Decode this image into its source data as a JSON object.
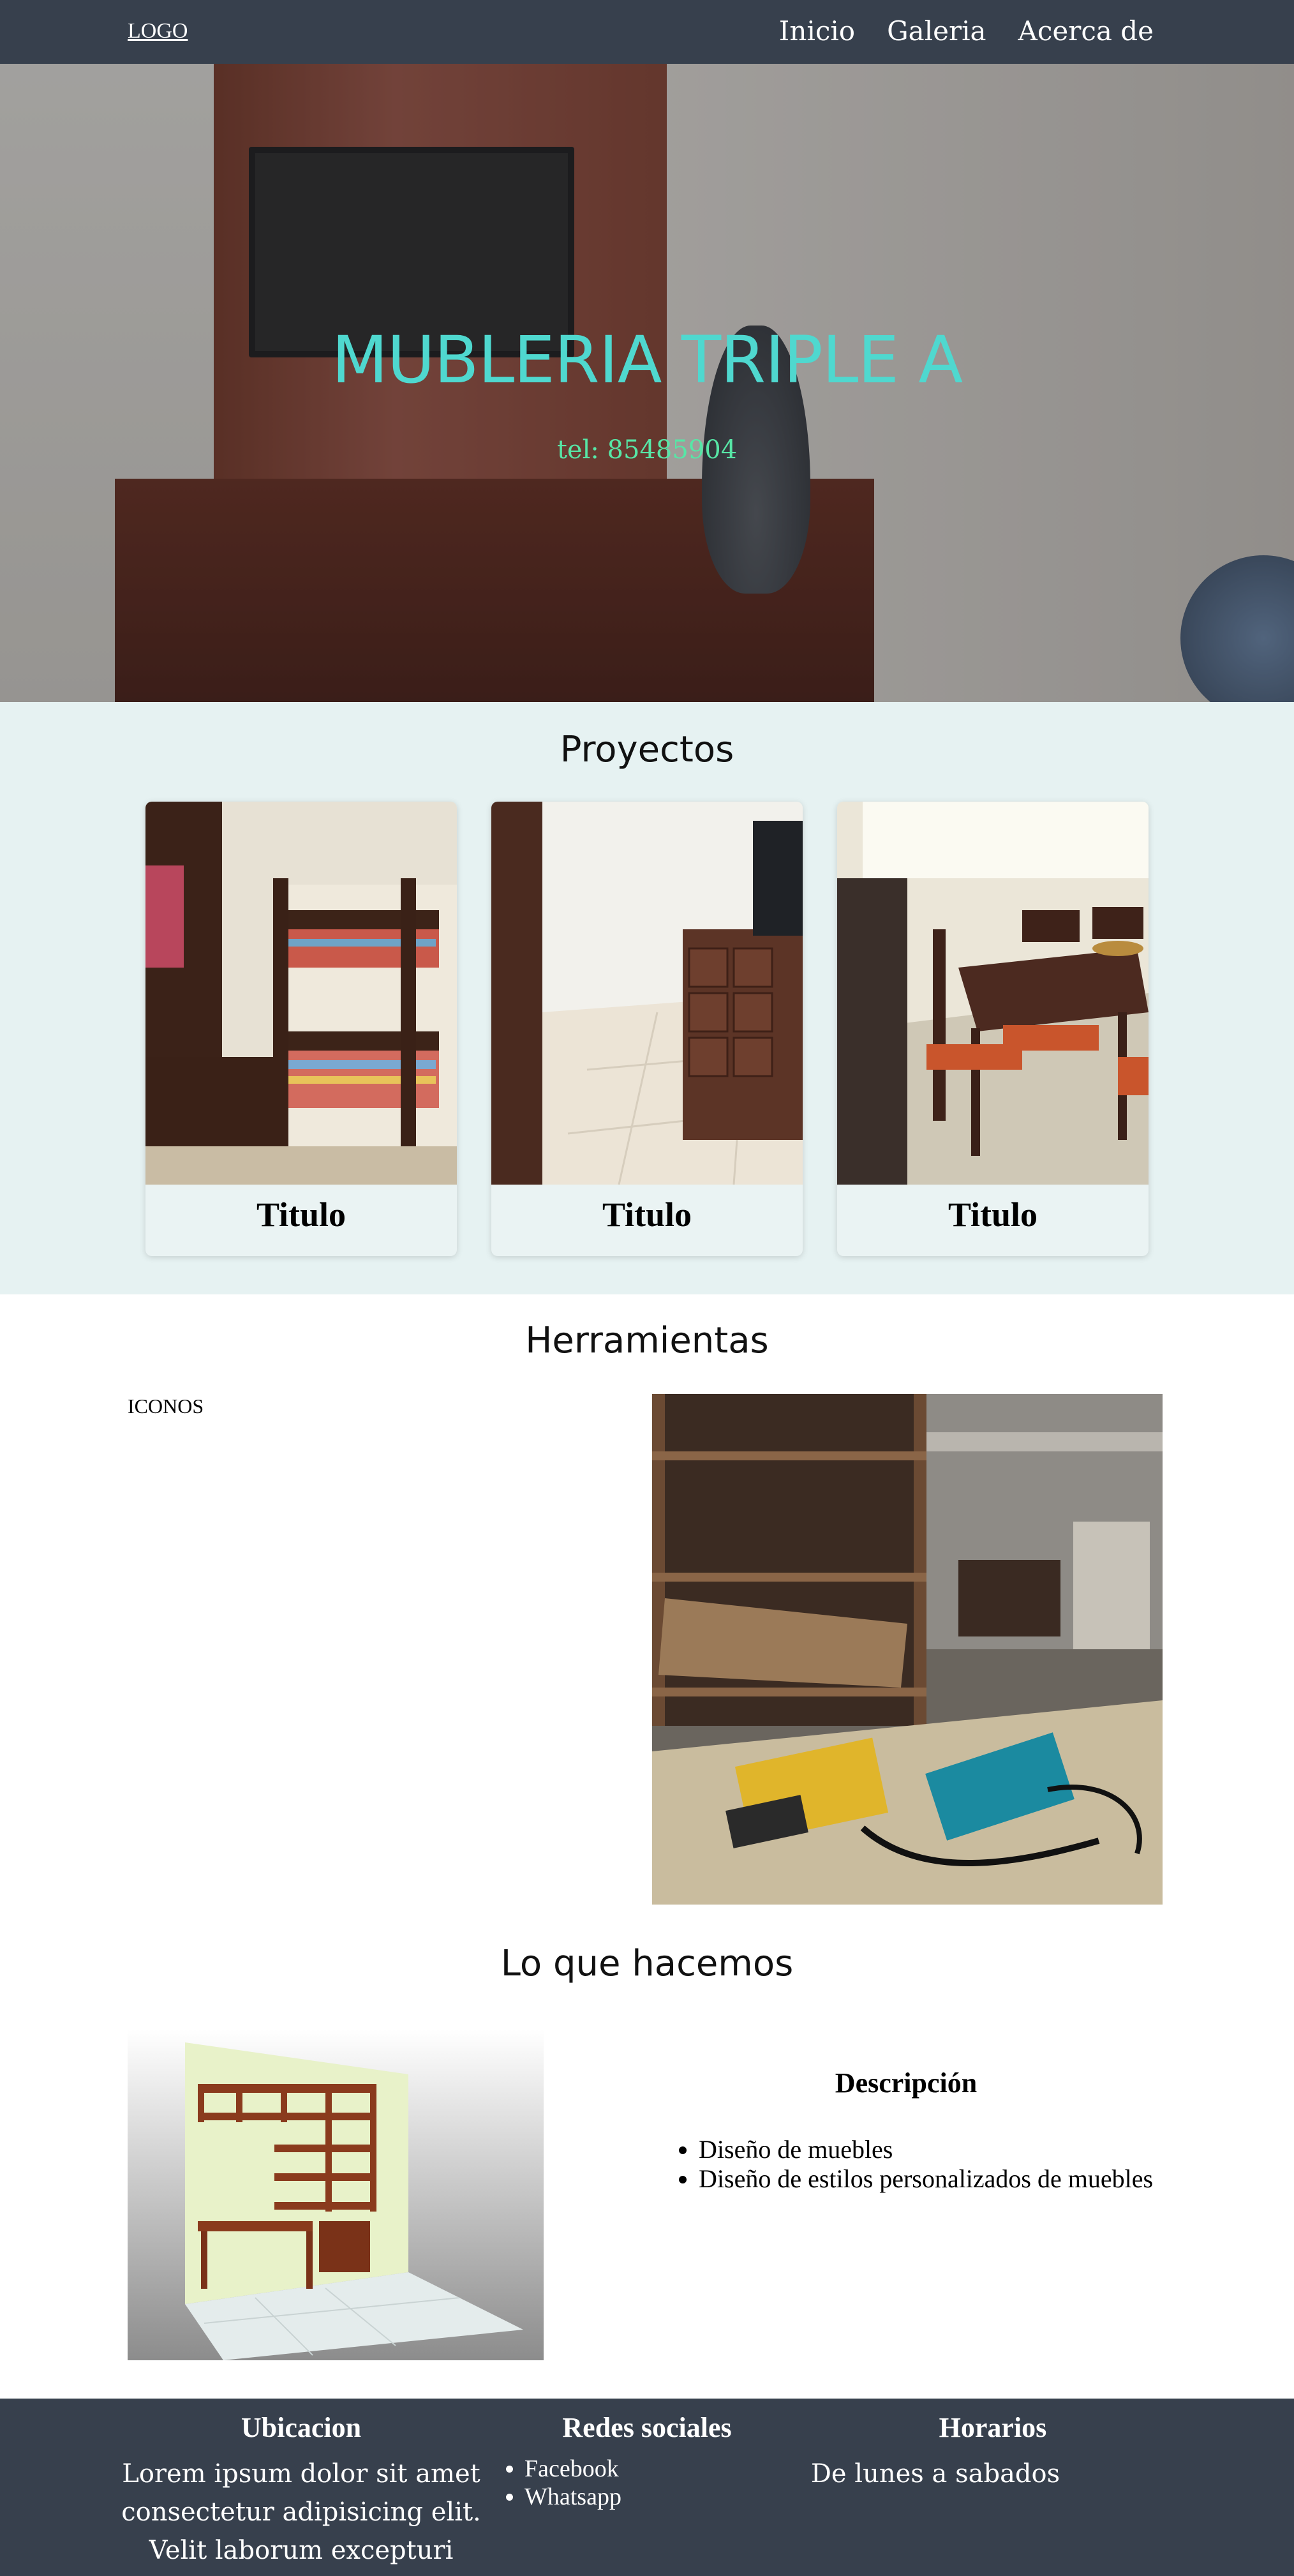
{
  "header": {
    "logo": "LOGO",
    "nav": [
      "Inicio",
      "Galeria",
      "Acerca de"
    ]
  },
  "hero": {
    "title": "MUBLERIA TRIPLE A",
    "tel": "tel: 85485904"
  },
  "proyectos": {
    "title": "Proyectos",
    "cards": [
      {
        "title": "Titulo"
      },
      {
        "title": "Titulo"
      },
      {
        "title": "Titulo"
      }
    ]
  },
  "herramientas": {
    "title": "Herramientas",
    "iconos": "ICONOS"
  },
  "hacemos": {
    "title": "Lo que hacemos",
    "desc_title": "Descripción",
    "items": [
      "Diseño de muebles",
      "Diseño de estilos personalizados de muebles"
    ]
  },
  "footer": {
    "ubicacion_title": "Ubicacion",
    "ubicacion_text": [
      "Lorem ipsum dolor sit amet",
      "consectetur adipisicing elit.",
      "Velit laborum excepturi"
    ],
    "redes_title": "Redes sociales",
    "redes": [
      "Facebook",
      "Whatsapp"
    ],
    "horarios_title": "Horarios",
    "horarios_text": "De lunes a sabados"
  },
  "colors": {
    "header_bg": "#37404d",
    "hero_title": "#4fd8cf",
    "hero_tel": "#57e6a6",
    "proyectos_bg": "#e6f2f2"
  }
}
